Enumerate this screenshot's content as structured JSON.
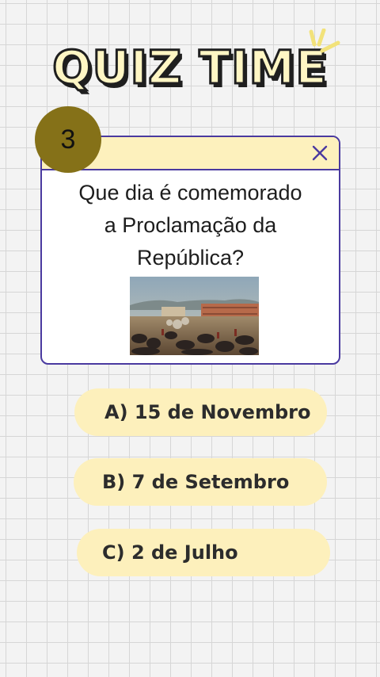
{
  "header": {
    "title": "QUIZ TIME"
  },
  "question": {
    "number": "3",
    "text": "Que dia é comemorado\na Proclamação da\nRepública?"
  },
  "answers": [
    {
      "label": "A) 15 de Novembro"
    },
    {
      "label": "B) 7 de Setembro"
    },
    {
      "label": "C) 2 de Julho"
    }
  ],
  "colors": {
    "accent_border": "#4a3aa0",
    "badge": "#857118",
    "answer_bg": "#fdf0bc",
    "header_bg": "#fdf1bd"
  },
  "icons": {
    "close": "close-icon",
    "sparkle": "sparkle-icon"
  }
}
